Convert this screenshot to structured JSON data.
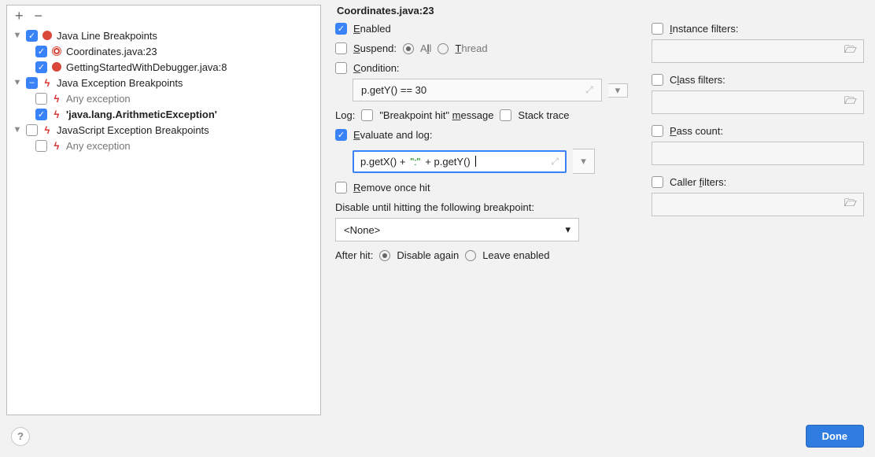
{
  "toolbar": {
    "plus": "+",
    "minus": "−"
  },
  "tree": {
    "g1": {
      "label": "Java Line Breakpoints",
      "i1": "Coordinates.java:23",
      "i2": "GettingStartedWithDebugger.java:8"
    },
    "g2": {
      "label": "Java Exception Breakpoints",
      "i1": "Any exception",
      "i2": "'java.lang.ArithmeticException'"
    },
    "g3": {
      "label": "JavaScript Exception Breakpoints",
      "i1": "Any exception"
    }
  },
  "details": {
    "title": "Coordinates.java:23",
    "enabled_label": "Enabled",
    "suspend_label": "Suspend:",
    "suspend_all": "All",
    "suspend_thread": "Thread",
    "condition_label": "Condition:",
    "condition_placeholder": "p.getY() == 30",
    "log_label": "Log:",
    "log_bp_msg": "\"Breakpoint hit\" message",
    "log_stack": "Stack trace",
    "eval_label": "Evaluate and log:",
    "eval_prefix": "p.getX() + ",
    "eval_str": "\":\"",
    "eval_suffix": " + p.getY()",
    "remove_label": "Remove once hit",
    "disable_until_label": "Disable until hitting the following breakpoint:",
    "disable_select": "<None>",
    "after_hit_label": "After hit:",
    "after_disable": "Disable again",
    "after_leave": "Leave enabled",
    "instance_filters": "Instance filters:",
    "class_filters": "Class filters:",
    "pass_count": "Pass count:",
    "caller_filters": "Caller filters:"
  },
  "footer": {
    "help": "?",
    "done": "Done"
  }
}
